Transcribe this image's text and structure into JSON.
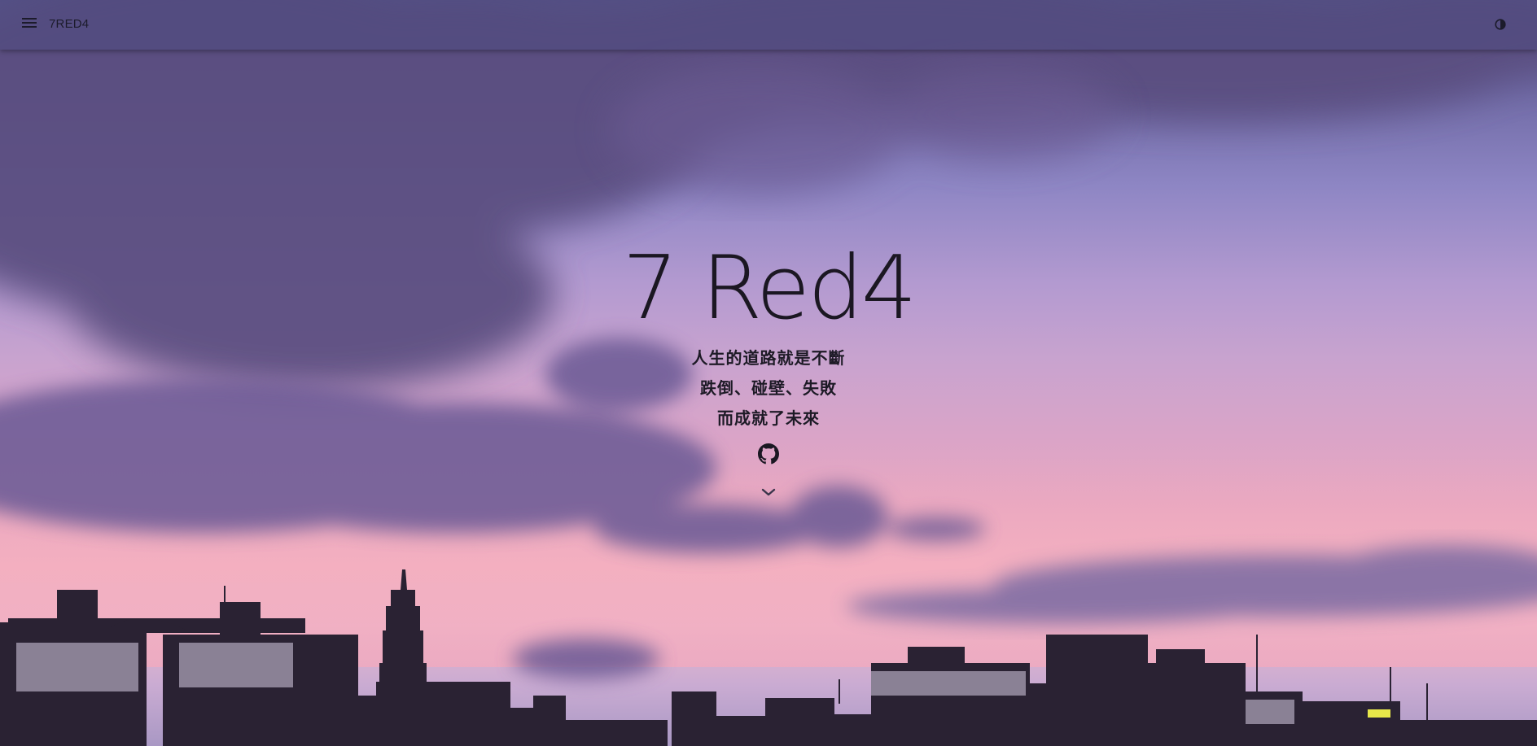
{
  "appbar": {
    "menu_icon": "menu-icon",
    "brand": "7RED4",
    "theme_icon": "contrast-icon"
  },
  "hero": {
    "title": "7 Red4",
    "lines": [
      "人生的道路就是不斷",
      "跌倒、碰壁、失敗",
      "而成就了未來"
    ],
    "github_icon": "github-icon",
    "scroll_icon": "chevron-down-icon"
  },
  "colors": {
    "appbar_bg": "#4e4a80",
    "text_dark": "#1b1722",
    "sky_top": "#5b5a90",
    "sky_pink": "#f2b0c1"
  }
}
